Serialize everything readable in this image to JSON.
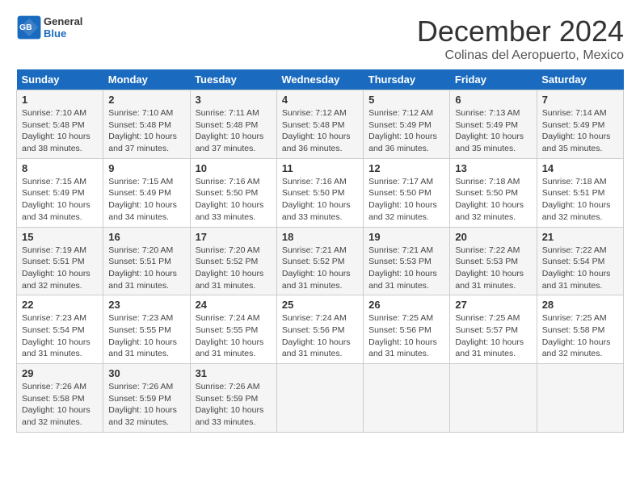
{
  "logo": {
    "text_general": "General",
    "text_blue": "Blue"
  },
  "header": {
    "month_title": "December 2024",
    "subtitle": "Colinas del Aeropuerto, Mexico"
  },
  "days_of_week": [
    "Sunday",
    "Monday",
    "Tuesday",
    "Wednesday",
    "Thursday",
    "Friday",
    "Saturday"
  ],
  "weeks": [
    [
      {
        "day": "1",
        "info": "Sunrise: 7:10 AM\nSunset: 5:48 PM\nDaylight: 10 hours\nand 38 minutes."
      },
      {
        "day": "2",
        "info": "Sunrise: 7:10 AM\nSunset: 5:48 PM\nDaylight: 10 hours\nand 37 minutes."
      },
      {
        "day": "3",
        "info": "Sunrise: 7:11 AM\nSunset: 5:48 PM\nDaylight: 10 hours\nand 37 minutes."
      },
      {
        "day": "4",
        "info": "Sunrise: 7:12 AM\nSunset: 5:48 PM\nDaylight: 10 hours\nand 36 minutes."
      },
      {
        "day": "5",
        "info": "Sunrise: 7:12 AM\nSunset: 5:49 PM\nDaylight: 10 hours\nand 36 minutes."
      },
      {
        "day": "6",
        "info": "Sunrise: 7:13 AM\nSunset: 5:49 PM\nDaylight: 10 hours\nand 35 minutes."
      },
      {
        "day": "7",
        "info": "Sunrise: 7:14 AM\nSunset: 5:49 PM\nDaylight: 10 hours\nand 35 minutes."
      }
    ],
    [
      {
        "day": "8",
        "info": "Sunrise: 7:15 AM\nSunset: 5:49 PM\nDaylight: 10 hours\nand 34 minutes."
      },
      {
        "day": "9",
        "info": "Sunrise: 7:15 AM\nSunset: 5:49 PM\nDaylight: 10 hours\nand 34 minutes."
      },
      {
        "day": "10",
        "info": "Sunrise: 7:16 AM\nSunset: 5:50 PM\nDaylight: 10 hours\nand 33 minutes."
      },
      {
        "day": "11",
        "info": "Sunrise: 7:16 AM\nSunset: 5:50 PM\nDaylight: 10 hours\nand 33 minutes."
      },
      {
        "day": "12",
        "info": "Sunrise: 7:17 AM\nSunset: 5:50 PM\nDaylight: 10 hours\nand 32 minutes."
      },
      {
        "day": "13",
        "info": "Sunrise: 7:18 AM\nSunset: 5:50 PM\nDaylight: 10 hours\nand 32 minutes."
      },
      {
        "day": "14",
        "info": "Sunrise: 7:18 AM\nSunset: 5:51 PM\nDaylight: 10 hours\nand 32 minutes."
      }
    ],
    [
      {
        "day": "15",
        "info": "Sunrise: 7:19 AM\nSunset: 5:51 PM\nDaylight: 10 hours\nand 32 minutes."
      },
      {
        "day": "16",
        "info": "Sunrise: 7:20 AM\nSunset: 5:51 PM\nDaylight: 10 hours\nand 31 minutes."
      },
      {
        "day": "17",
        "info": "Sunrise: 7:20 AM\nSunset: 5:52 PM\nDaylight: 10 hours\nand 31 minutes."
      },
      {
        "day": "18",
        "info": "Sunrise: 7:21 AM\nSunset: 5:52 PM\nDaylight: 10 hours\nand 31 minutes."
      },
      {
        "day": "19",
        "info": "Sunrise: 7:21 AM\nSunset: 5:53 PM\nDaylight: 10 hours\nand 31 minutes."
      },
      {
        "day": "20",
        "info": "Sunrise: 7:22 AM\nSunset: 5:53 PM\nDaylight: 10 hours\nand 31 minutes."
      },
      {
        "day": "21",
        "info": "Sunrise: 7:22 AM\nSunset: 5:54 PM\nDaylight: 10 hours\nand 31 minutes."
      }
    ],
    [
      {
        "day": "22",
        "info": "Sunrise: 7:23 AM\nSunset: 5:54 PM\nDaylight: 10 hours\nand 31 minutes."
      },
      {
        "day": "23",
        "info": "Sunrise: 7:23 AM\nSunset: 5:55 PM\nDaylight: 10 hours\nand 31 minutes."
      },
      {
        "day": "24",
        "info": "Sunrise: 7:24 AM\nSunset: 5:55 PM\nDaylight: 10 hours\nand 31 minutes."
      },
      {
        "day": "25",
        "info": "Sunrise: 7:24 AM\nSunset: 5:56 PM\nDaylight: 10 hours\nand 31 minutes."
      },
      {
        "day": "26",
        "info": "Sunrise: 7:25 AM\nSunset: 5:56 PM\nDaylight: 10 hours\nand 31 minutes."
      },
      {
        "day": "27",
        "info": "Sunrise: 7:25 AM\nSunset: 5:57 PM\nDaylight: 10 hours\nand 31 minutes."
      },
      {
        "day": "28",
        "info": "Sunrise: 7:25 AM\nSunset: 5:58 PM\nDaylight: 10 hours\nand 32 minutes."
      }
    ],
    [
      {
        "day": "29",
        "info": "Sunrise: 7:26 AM\nSunset: 5:58 PM\nDaylight: 10 hours\nand 32 minutes."
      },
      {
        "day": "30",
        "info": "Sunrise: 7:26 AM\nSunset: 5:59 PM\nDaylight: 10 hours\nand 32 minutes."
      },
      {
        "day": "31",
        "info": "Sunrise: 7:26 AM\nSunset: 5:59 PM\nDaylight: 10 hours\nand 33 minutes."
      },
      {
        "day": "",
        "info": ""
      },
      {
        "day": "",
        "info": ""
      },
      {
        "day": "",
        "info": ""
      },
      {
        "day": "",
        "info": ""
      }
    ]
  ]
}
